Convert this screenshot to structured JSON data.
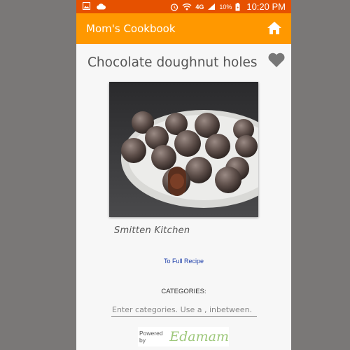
{
  "status_bar": {
    "time": "10:20 PM",
    "battery_percent": "10%",
    "network": "4G"
  },
  "app_bar": {
    "title": "Mom's Cookbook"
  },
  "recipe": {
    "title": "Chocolate doughnut holes",
    "source": "Smitten Kitchen",
    "full_recipe_link": "To Full Recipe"
  },
  "categories": {
    "label": "CATEGORIES:",
    "placeholder": "Enter categories. Use a , inbetween."
  },
  "attribution": {
    "powered_by": "Powered by",
    "brand": "Edamam"
  },
  "colors": {
    "status_bar": "#e65100",
    "app_bar": "#ff9800",
    "link": "#1a3ba8",
    "brand": "#9ec87b"
  },
  "icons": [
    "image-icon",
    "cloud-icon",
    "alarm-icon",
    "wifi-icon",
    "signal-icon",
    "battery-icon",
    "home-icon",
    "heart-icon"
  ]
}
